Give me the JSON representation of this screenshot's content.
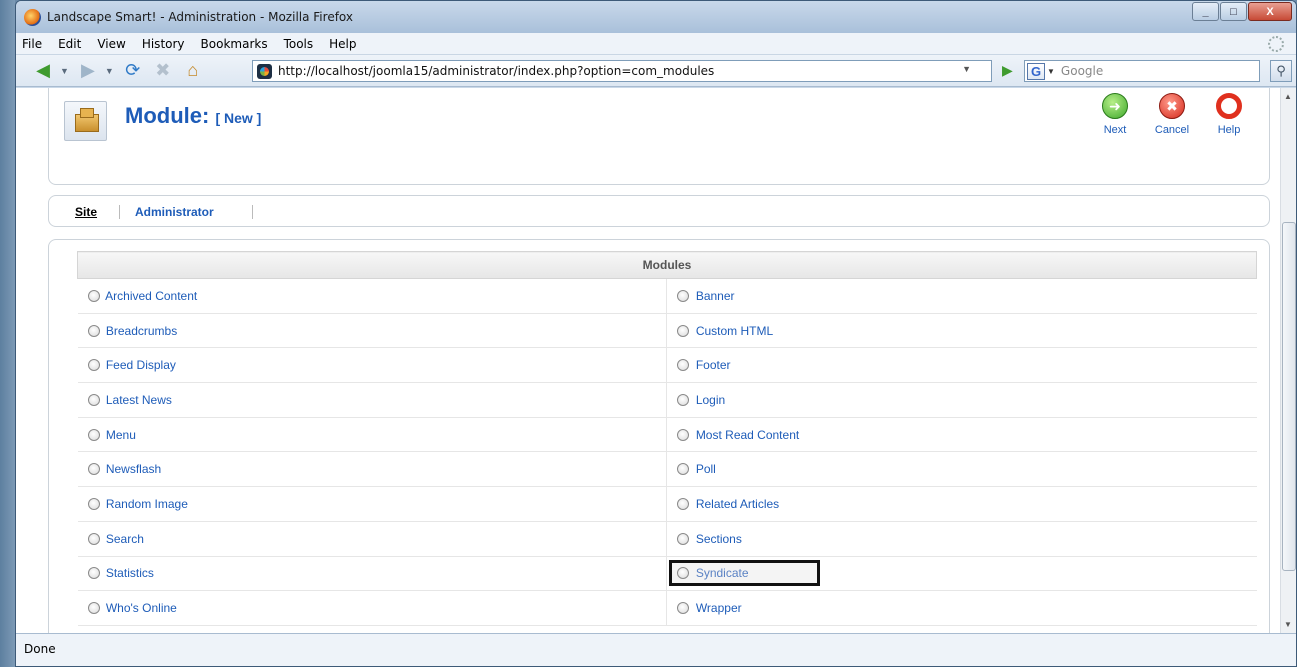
{
  "window": {
    "title": "Landscape Smart! - Administration - Mozilla Firefox",
    "buttons": [
      "_",
      "□",
      "X"
    ]
  },
  "menubar": {
    "items": [
      "File",
      "Edit",
      "View",
      "History",
      "Bookmarks",
      "Tools",
      "Help"
    ]
  },
  "navbar": {
    "url": "http://localhost/joomla15/administrator/index.php?option=com_modules",
    "search_placeholder": "Google",
    "search_engine_letter": "G"
  },
  "page": {
    "title": "Module:",
    "subtitle": "[ New ]"
  },
  "toolbar": {
    "next_label": "Next",
    "cancel_label": "Cancel",
    "help_label": "Help"
  },
  "tabs": {
    "site": "Site",
    "administrator": "Administrator"
  },
  "modules": {
    "header": "Modules",
    "left": [
      "Archived Content",
      "Breadcrumbs",
      "Feed Display",
      "Latest News",
      "Menu",
      "Newsflash",
      "Random Image",
      "Search",
      "Statistics",
      "Who's Online"
    ],
    "right": [
      "Banner",
      "Custom HTML",
      "Footer",
      "Login",
      "Most Read Content",
      "Poll",
      "Related Articles",
      "Sections",
      "Syndicate",
      "Wrapper"
    ]
  },
  "status": {
    "text": "Done"
  },
  "colors": {
    "link": "#1e5cb8",
    "title": "#1e5cb8"
  }
}
